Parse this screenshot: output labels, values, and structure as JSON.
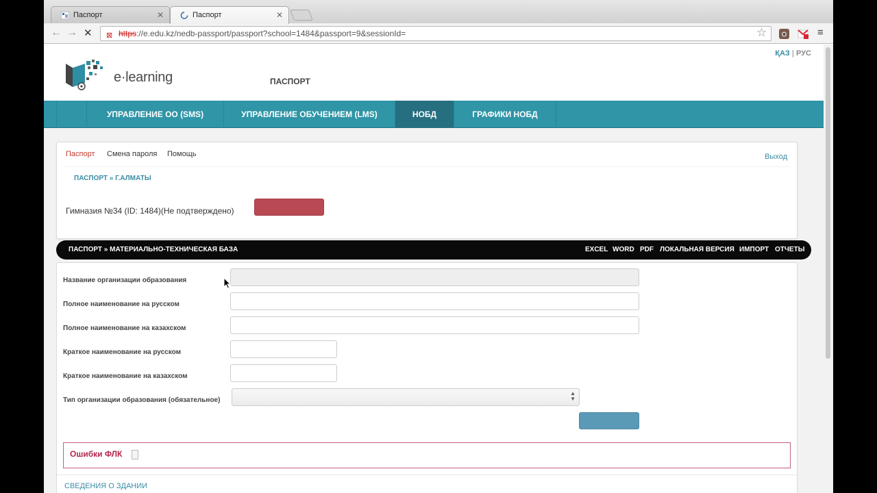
{
  "browser": {
    "tabs": [
      {
        "title": "Паспорт"
      },
      {
        "title": "Паспорт"
      }
    ],
    "url_scheme": "https",
    "url_rest": "://e.edu.kz/nedb-passport/passport?school=1484&passport=9&sessionId="
  },
  "header": {
    "logo_text": "e·learning",
    "title": "ПАСПОРТ",
    "lang_kz": "ҚАЗ",
    "lang_sep": "|",
    "lang_ru": "РУС"
  },
  "nav": {
    "items": [
      {
        "label": "УПРАВЛЕНИЕ ОО (SMS)"
      },
      {
        "label": "УПРАВЛЕНИЕ ОБУЧЕНИЕМ (LMS)"
      },
      {
        "label": "НОБД"
      },
      {
        "label": "ГРАФИКИ НОБД"
      }
    ]
  },
  "subnav": {
    "passport": "Паспорт",
    "change_password": "Смена пароля",
    "help": "Помощь",
    "logout": "Выход"
  },
  "breadcrumb": "ПАСПОРТ  »  Г.АЛМАТЫ",
  "school_status": "Гимназия №34 (ID: 1484)(Не подтверждено)",
  "section_bar": {
    "crumb": "ПАСПОРТ  »  МАТЕРИАЛЬНО-ТЕХНИЧЕСКАЯ БАЗА",
    "links": [
      "EXCEL",
      "WORD",
      "PDF",
      "ЛОКАЛЬНАЯ ВЕРСИЯ",
      "ИМПОРТ",
      "ОТЧЕТЫ"
    ]
  },
  "form": {
    "fields": [
      {
        "label": "Название организации образования",
        "value": ""
      },
      {
        "label": "Полное наименование на русском",
        "value": ""
      },
      {
        "label": "Полное наименование на казахском",
        "value": ""
      },
      {
        "label": "Краткое наименование на русском",
        "value": ""
      },
      {
        "label": "Краткое наименование на казахском",
        "value": ""
      },
      {
        "label": "Тип организации образования (обязательное)",
        "value": ""
      }
    ]
  },
  "flk_errors_title": "Ошибки ФЛК",
  "building_section": "СВЕДЕНИЯ О ЗДАНИИ",
  "colors": {
    "nav": "#2f95a7",
    "accent_red": "#b94a54",
    "link": "#3a8ca5",
    "submit": "#5a9ab6"
  }
}
